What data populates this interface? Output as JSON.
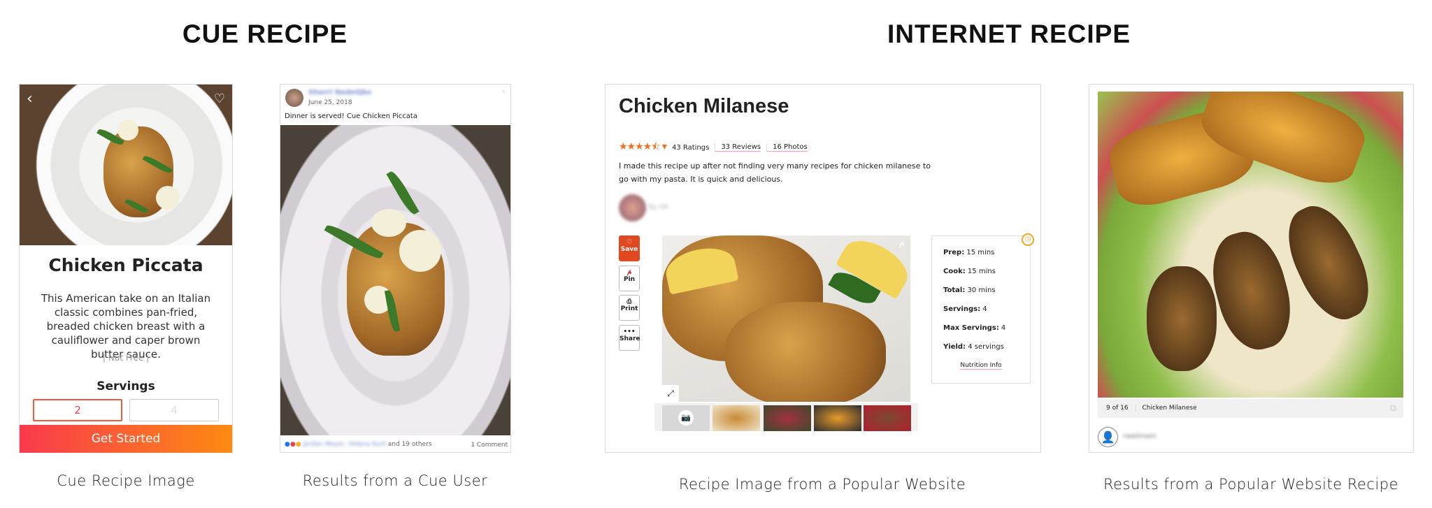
{
  "headings": {
    "cue": "CUE RECIPE",
    "internet": "INTERNET RECIPE"
  },
  "captions": {
    "cue_image": "Cue Recipe Image",
    "cue_user": "Results from a Cue User",
    "website_image": "Recipe Image from a Popular Website",
    "website_results": "Results from a Popular Website Recipe"
  },
  "cue_card": {
    "title": "Chicken Piccata",
    "description": "This American take on an Italian classic combines pan-fried, breaded chicken breast with a cauliflower and caper brown butter sauce.",
    "tags": "| Nut Free |",
    "servings_label": "Servings",
    "servings_options": [
      "2",
      "4"
    ],
    "selected_serving": "2",
    "cta": "Get Started",
    "icons": {
      "back": "chevron-left-icon",
      "favorite": "heart-icon"
    },
    "colors": {
      "gradient_start": "#f93a4e",
      "gradient_end": "#fd8a12",
      "selected_border": "#f05a3a"
    }
  },
  "facebook_post": {
    "author": "Sherri Nedelijko",
    "date": "June 25, 2018",
    "text": "Dinner is served! Cue Chicken Piccata",
    "reactions_names": "Jordan Meyer, Aldana Kunl",
    "reactions_suffix": "and 19 others",
    "comments": "1 Comment"
  },
  "website_recipe": {
    "title": "Chicken Milanese",
    "rating": 4.5,
    "ratings": "43 Ratings",
    "reviews": "33 Reviews",
    "photos": "16 Photos",
    "description": "I made this recipe up after not finding very many recipes for chicken milanese to go with my pasta. It is quick and delicious.",
    "byline": "By GR",
    "actions": [
      {
        "label": "Save",
        "icon": "heart-icon"
      },
      {
        "label": "Pin",
        "icon": "pinterest-icon"
      },
      {
        "label": "Print",
        "icon": "printer-icon"
      },
      {
        "label": "Share",
        "icon": "more-icon"
      }
    ],
    "info": [
      {
        "label": "Prep:",
        "value": "15 mins"
      },
      {
        "label": "Cook:",
        "value": "15 mins"
      },
      {
        "label": "Total:",
        "value": "30 mins"
      },
      {
        "label": "Servings:",
        "value": "4"
      },
      {
        "label": "Max Servings:",
        "value": "4"
      },
      {
        "label": "Yield:",
        "value": "4 servings"
      }
    ],
    "nutrition_link": "Nutrition Info",
    "colors": {
      "accent": "#e0481f",
      "star": "#f26f1c"
    }
  },
  "website_results": {
    "counter": "9 of 16",
    "photo_title": "Chicken Milanese",
    "username": "rawlinsen"
  }
}
